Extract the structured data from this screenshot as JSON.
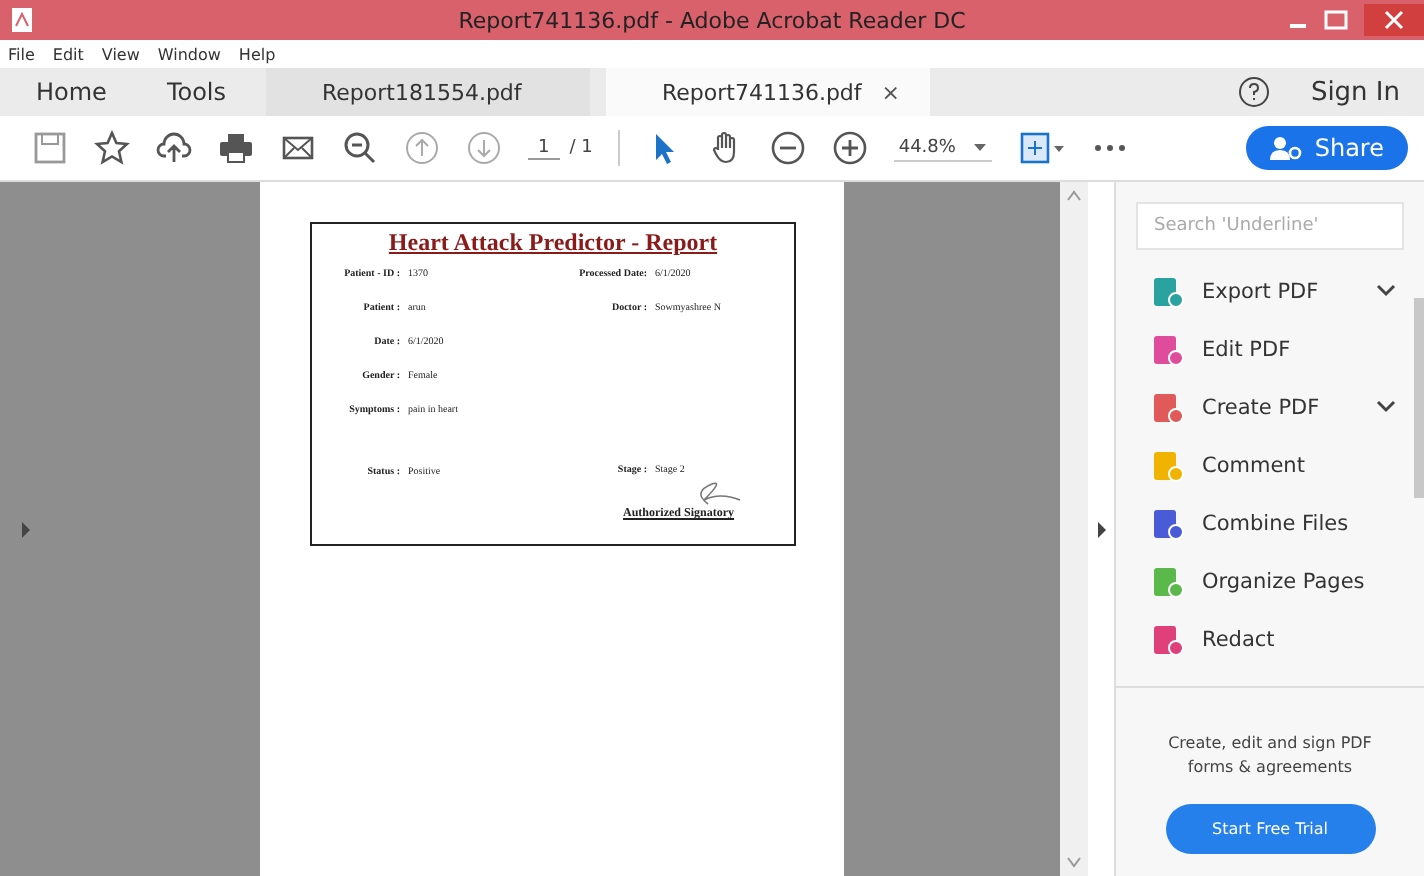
{
  "window": {
    "title": "Report741136.pdf - Adobe Acrobat Reader DC"
  },
  "menu": [
    "File",
    "Edit",
    "View",
    "Window",
    "Help"
  ],
  "tabs": [
    {
      "label": "Home",
      "kind": "nav",
      "selected": false
    },
    {
      "label": "Tools",
      "kind": "nav",
      "selected": false
    },
    {
      "label": "Report181554.pdf",
      "kind": "doc",
      "selected": false
    },
    {
      "label": "Report741136.pdf",
      "kind": "doc",
      "selected": true,
      "close": "×"
    }
  ],
  "account": {
    "sign_in": "Sign In"
  },
  "toolbar": {
    "page": "1",
    "page_total": "/ 1",
    "zoom": "44.8%",
    "share": "Share"
  },
  "report": {
    "title": "Heart Attack Predictor - Report",
    "left": [
      {
        "label": "Patient - ID :",
        "value": "1370"
      },
      {
        "label": "Patient :",
        "value": "arun"
      },
      {
        "label": "Date :",
        "value": "6/1/2020"
      },
      {
        "label": "Gender :",
        "value": "Female"
      },
      {
        "label": "Symptoms :",
        "value": "pain in heart"
      },
      {
        "label": "Status :",
        "value": "Positive"
      }
    ],
    "right": [
      {
        "label": "Processed Date:",
        "value": "6/1/2020"
      },
      {
        "label": "Doctor :",
        "value": "Sowmyashree N"
      },
      {
        "label": "Stage :",
        "value": "Stage 2"
      }
    ],
    "signatory": "Authorized Signatory"
  },
  "tools_panel": {
    "search": {
      "placeholder": "Search 'Underline'"
    },
    "items": [
      {
        "label": "Export PDF",
        "color": "#2aa3a0",
        "has_menu": true
      },
      {
        "label": "Edit PDF",
        "color": "#e04c9c",
        "has_menu": false
      },
      {
        "label": "Create PDF",
        "color": "#e05a5a",
        "has_menu": true
      },
      {
        "label": "Comment",
        "color": "#f0b400",
        "has_menu": false
      },
      {
        "label": "Combine Files",
        "color": "#4a5bd8",
        "has_menu": false
      },
      {
        "label": "Organize Pages",
        "color": "#5bb84a",
        "has_menu": false
      },
      {
        "label": "Redact",
        "color": "#e0407a",
        "has_menu": false
      }
    ],
    "promo": "Create, edit and sign PDF forms & agreements",
    "trial": "Start Free Trial"
  }
}
